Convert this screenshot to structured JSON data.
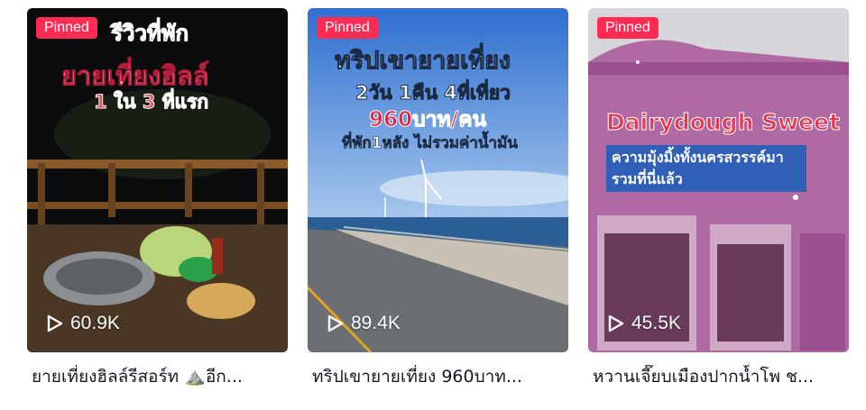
{
  "cards": [
    {
      "pinned_label": "Pinned",
      "views": "60.9K",
      "caption": "ยายเที่ยงฮิลล์รีสอร์ท ⛰️อีก...",
      "overlay": {
        "line1": "รีวิวที่พัก",
        "line2": "ยายเที่ยงฮิลล์",
        "line3": "1 ใน 3 ที่แรก"
      },
      "icon": "play-icon"
    },
    {
      "pinned_label": "Pinned",
      "views": "89.4K",
      "caption": "ทริปเขายายเที่ยง 960บาท...",
      "overlay": {
        "line1": "ทริปเขายายเที่ยง",
        "line2": "2วัน 1คืน 4ที่เที่ยว",
        "line3": "960บาท/คน",
        "line4": "ที่พัก1หลัง ไม่รวมค่าน้ำมัน"
      },
      "icon": "play-icon"
    },
    {
      "pinned_label": "Pinned",
      "views": "45.5K",
      "caption": "หวานเจี๊ยบเมืองปากน้ำโพ ช...",
      "overlay": {
        "line1": "Dairydough Sweet",
        "line2": "ความมุ้งมิ้งทั้งนครสวรรค์มารวมที่นี่แล้ว"
      },
      "icon": "play-icon"
    }
  ],
  "colors": {
    "pinned_bg": "#fe2c55",
    "caption_text": "#161823"
  }
}
